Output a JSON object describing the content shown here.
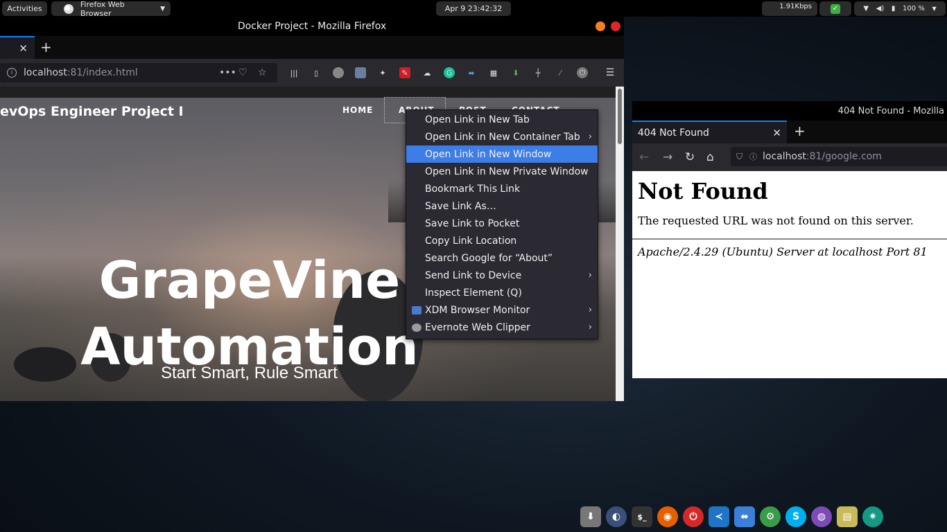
{
  "topbar": {
    "activities": "Activities",
    "app_name": "Firefox Web Browser",
    "clock": "Apr 9  23:42:32",
    "net_speed": "1.91Kbps",
    "battery": "100 %"
  },
  "main_window": {
    "title": "Docker Project - Mozilla Firefox",
    "url_host": "localhost",
    "url_rest": ":81/index.html",
    "page": {
      "brand": "evOps Engineer Project I",
      "nav": [
        "HOME",
        "ABOUT",
        "POST",
        "CONTACT"
      ],
      "hero_title_line1": "GrapeVine",
      "hero_title_line2": "Automation",
      "hero_subtitle": "Start Smart, Rule Smart"
    }
  },
  "context_menu": {
    "items": [
      {
        "label": "Open Link in New Tab",
        "submenu": false
      },
      {
        "label": "Open Link in New Container Tab",
        "submenu": true
      },
      {
        "label": "Open Link in New Window",
        "submenu": false,
        "highlighted": true
      },
      {
        "label": "Open Link in New Private Window",
        "submenu": false
      },
      {
        "label": "Bookmark This Link",
        "submenu": false
      },
      {
        "label": "Save Link As…",
        "submenu": false
      },
      {
        "label": "Save Link to Pocket",
        "submenu": false
      },
      {
        "label": "Copy Link Location",
        "submenu": false
      },
      {
        "label": "Search Google for “About”",
        "submenu": false
      },
      {
        "label": "Send Link to Device",
        "submenu": true
      },
      {
        "label": "Inspect Element (Q)",
        "submenu": false
      },
      {
        "label": "XDM Browser Monitor",
        "submenu": true
      },
      {
        "label": "Evernote Web Clipper",
        "submenu": true
      }
    ],
    "highlight_color": "#3d7de8"
  },
  "second_window": {
    "title": "404 Not Found - Mozilla",
    "tab_label": "404 Not Found",
    "url_host": "localhost",
    "url_rest": ":81/google.com",
    "heading": "Not Found",
    "message": "The requested URL was not found on this server.",
    "address": "Apache/2.4.29 (Ubuntu) Server at localhost Port 81"
  },
  "dock": {
    "icons": [
      "installer-icon",
      "eclipse-icon",
      "terminal-icon",
      "firefox-icon",
      "power-icon",
      "vscode-icon",
      "xdm-icon",
      "settings-gear-icon",
      "skype-icon",
      "tor-icon",
      "archive-manager-icon",
      "aperture-icon"
    ]
  }
}
